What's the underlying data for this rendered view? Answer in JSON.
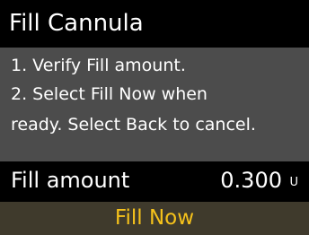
{
  "header": {
    "title": "Fill Cannula"
  },
  "instructions": {
    "line1": "1. Verify Fill amount.",
    "line2": "2. Select Fill Now when",
    "line3": "ready. Select Back to cancel."
  },
  "fill_amount": {
    "label": "Fill amount",
    "value": "0.300",
    "unit": "U"
  },
  "action": {
    "fill_now_label": "Fill Now"
  },
  "colors": {
    "accent": "#f6c21b",
    "title_bg": "#000000",
    "body_bg": "#4c4c4c",
    "action_bg": "#3f3a2c"
  }
}
